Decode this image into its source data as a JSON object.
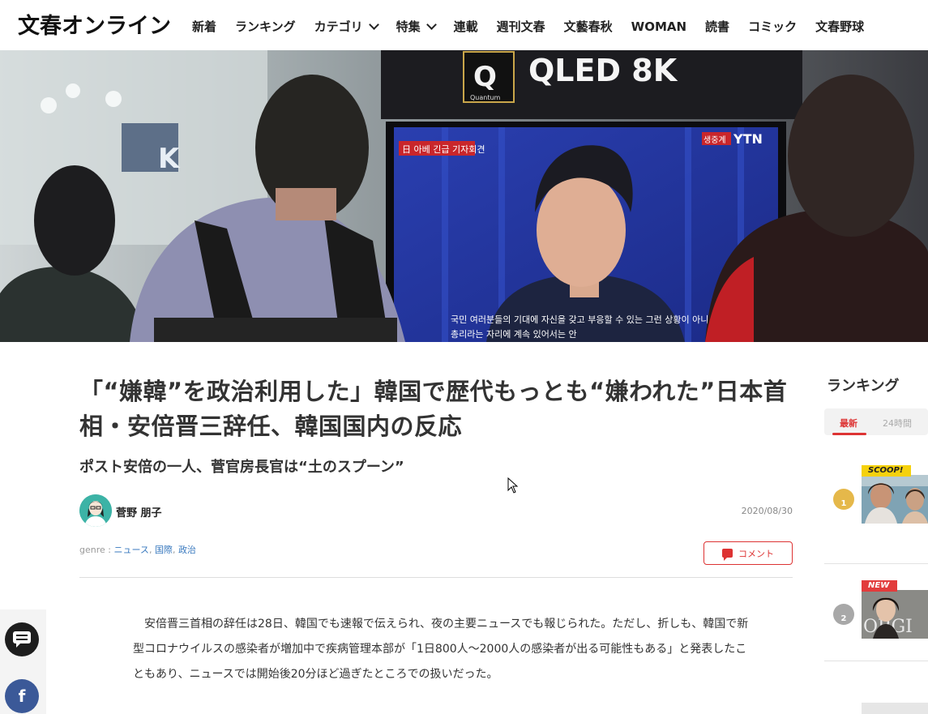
{
  "header": {
    "logo": "文春オンライン",
    "nav": [
      {
        "label": "新着",
        "dropdown": false
      },
      {
        "label": "ランキング",
        "dropdown": false
      },
      {
        "label": "カテゴリ",
        "dropdown": true
      },
      {
        "label": "特集",
        "dropdown": true
      },
      {
        "label": "連載",
        "dropdown": false
      },
      {
        "label": "週刊文春",
        "dropdown": false
      },
      {
        "label": "文藝春秋",
        "dropdown": false
      },
      {
        "label": "WOMAN",
        "dropdown": false
      },
      {
        "label": "読書",
        "dropdown": false
      },
      {
        "label": "コミック",
        "dropdown": false
      },
      {
        "label": "文春野球",
        "dropdown": false
      }
    ]
  },
  "hero": {
    "signage": "QLED 8K",
    "signage_sub": "Quantum",
    "tv_channel": "YTN",
    "tv_live_tag": "생중계",
    "tv_banner": "日 아베 긴급 기자회견",
    "tv_caption_line1": "국민 여러분들의 기대에 자신을 갖고 부응할 수 있는 그런 상황이 아니게 된",
    "tv_caption_line2": "총리라는 자리에 계속 있어서는 안"
  },
  "article": {
    "title": "「“嫌韓”を政治利用した」韓国で歴代もっとも“嫌われた”日本首相・安倍晋三辞任、韓国国内の反応",
    "subtitle": "ポスト安倍の一人、菅官房長官は“土のスプーン”",
    "author": "菅野 朋子",
    "date": "2020/08/30",
    "genre_prefix": "genre : ",
    "genres": [
      "ニュース",
      "国際",
      "政治"
    ],
    "comment_label": "コメント",
    "body": "　安倍晋三首相の辞任は28日、韓国でも速報で伝えられ、夜の主要ニュースでも報じられた。ただし、折しも、韓国で新型コロナウイルスの感染者が増加中で疾病管理本部が「1日800人〜2000人の感染者が出る可能性もある」と発表したこともあり、ニュースでは開始後20分ほど過ぎたところでの扱いだった。"
  },
  "sidebar": {
    "title": "ランキング",
    "tabs": [
      "最新",
      "24時間"
    ],
    "active_tab": "最新",
    "items": [
      {
        "rank": "1",
        "label": "SCOOP!",
        "label_color": "#f5d10c",
        "medal_color": "#e5b84a"
      },
      {
        "rank": "2",
        "label": "NEW",
        "label_color": "#e23c3c",
        "medal_color": "#a8a8a8"
      }
    ]
  },
  "share": {
    "comment_icon": "comment-icon",
    "facebook_icon": "facebook-icon",
    "facebook_letter": "f"
  }
}
